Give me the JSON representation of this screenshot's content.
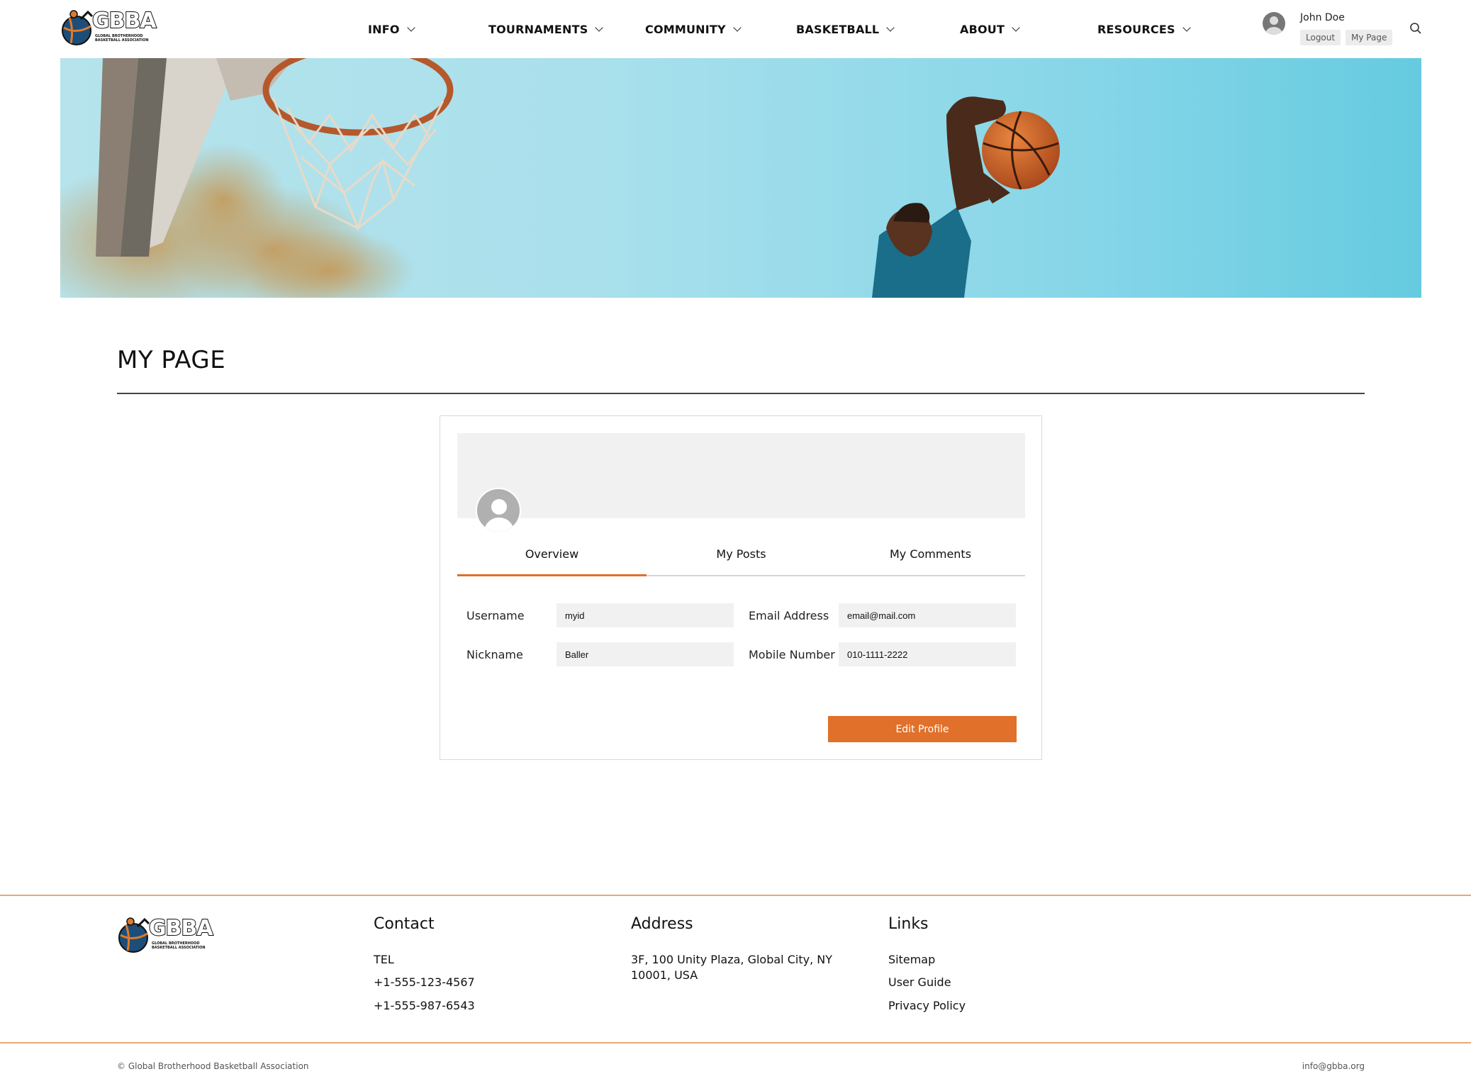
{
  "brand": {
    "name": "GBBA",
    "tagline": "GLOBAL BROTHERHOOD BASKETBALL ASSOCIATION"
  },
  "nav": {
    "items": [
      {
        "label": "INFO"
      },
      {
        "label": "TOURNAMENTS"
      },
      {
        "label": "COMMUNITY"
      },
      {
        "label": "BASKETBALL"
      },
      {
        "label": "ABOUT"
      },
      {
        "label": "RESOURCES"
      }
    ]
  },
  "user": {
    "name": "John Doe",
    "logout_label": "Logout",
    "mypage_label": "My Page"
  },
  "page": {
    "title": "MY PAGE"
  },
  "profile": {
    "tabs": [
      {
        "label": "Overview",
        "active": true
      },
      {
        "label": "My Posts",
        "active": false
      },
      {
        "label": "My Comments",
        "active": false
      }
    ],
    "fields": {
      "username": {
        "label": "Username",
        "value": "myid"
      },
      "email": {
        "label": "Email Address",
        "value": "email@mail.com"
      },
      "nickname": {
        "label": "Nickname",
        "value": "Baller"
      },
      "mobile": {
        "label": "Mobile Number",
        "value": "010-1111-2222"
      }
    },
    "edit_label": "Edit Profile"
  },
  "footer": {
    "contact": {
      "heading": "Contact",
      "tel_label": "TEL",
      "phones": [
        "+1-555-123-4567",
        "+1-555-987-6543"
      ]
    },
    "address": {
      "heading": "Address",
      "line1": "3F, 100 Unity Plaza, Global City, NY",
      "line2": "10001, USA"
    },
    "links": {
      "heading": "Links",
      "items": [
        "Sitemap",
        "User Guide",
        "Privacy Policy"
      ]
    },
    "copyright": "© Global Brotherhood Basketball Association",
    "email": "info@gbba.org"
  },
  "colors": {
    "accent": "#e0702a",
    "banner_sky": "#86d6e8"
  }
}
